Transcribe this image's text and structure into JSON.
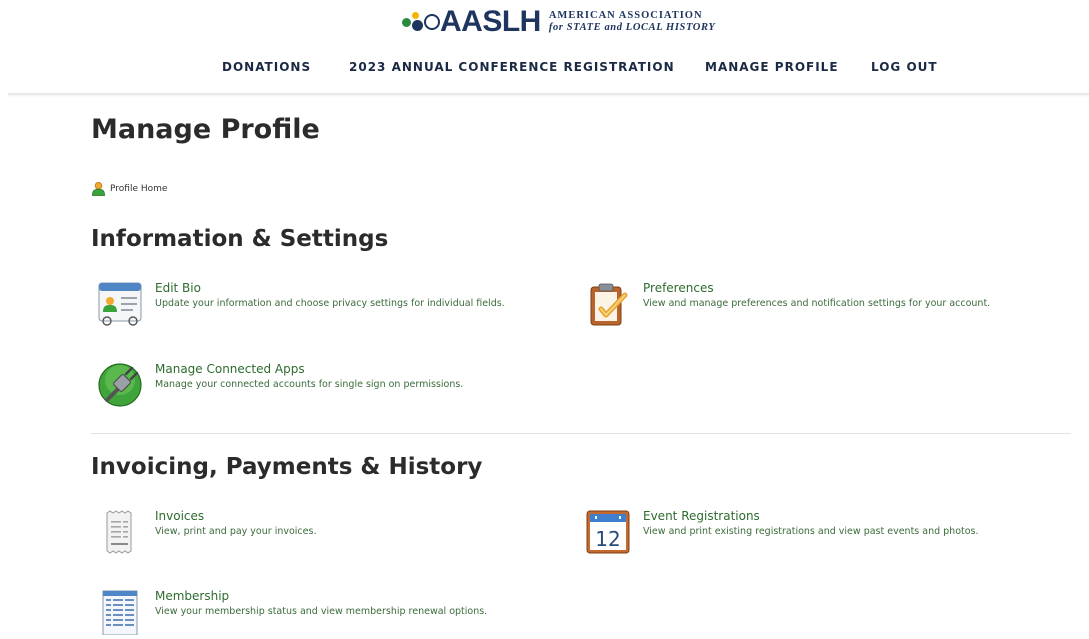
{
  "brand": {
    "wordmark": "AASLH",
    "tagline_line1": "AMERICAN ASSOCIATION",
    "tagline_line2": "for STATE and LOCAL HISTORY",
    "colors": {
      "navy": "#1e3560",
      "green": "#2b8a3e",
      "yellow": "#f2b705"
    }
  },
  "nav": {
    "items": [
      {
        "label": "DONATIONS"
      },
      {
        "label": "2023 ANNUAL CONFERENCE REGISTRATION"
      },
      {
        "label": "MANAGE PROFILE"
      },
      {
        "label": "LOG OUT"
      }
    ]
  },
  "page": {
    "title": "Manage Profile",
    "breadcrumb": {
      "label": "Profile Home",
      "icon": "user-icon"
    }
  },
  "sections": [
    {
      "heading": "Information & Settings",
      "items": [
        {
          "title": "Edit Bio",
          "desc": "Update your information and choose privacy settings for individual fields.",
          "icon": "contact-card-icon"
        },
        {
          "title": "Preferences",
          "desc": "View and manage preferences and notification settings for your account.",
          "icon": "clipboard-check-icon"
        },
        {
          "title": "Manage Connected Apps",
          "desc": "Manage your connected accounts for single sign on permissions.",
          "icon": "plug-icon"
        }
      ]
    },
    {
      "heading": "Invoicing, Payments & History",
      "items": [
        {
          "title": "Invoices",
          "desc": "View, print and pay your invoices.",
          "icon": "receipt-icon"
        },
        {
          "title": "Event Registrations",
          "desc": "View and print existing registrations and view past events and photos.",
          "icon": "calendar-icon",
          "day": "12"
        },
        {
          "title": "Membership",
          "desc": "View your membership status and view membership renewal options.",
          "icon": "spreadsheet-icon"
        }
      ]
    }
  ]
}
